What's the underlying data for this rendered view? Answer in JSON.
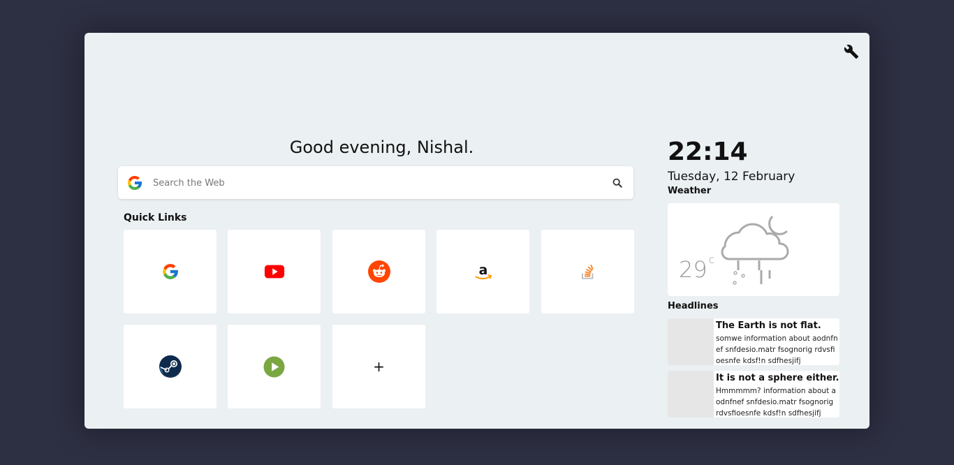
{
  "greeting": "Good evening, Nishal.",
  "search": {
    "placeholder": "Search the Web"
  },
  "quick_links": {
    "title": "Quick Links",
    "items": [
      {
        "icon": "google-icon"
      },
      {
        "icon": "youtube-icon"
      },
      {
        "icon": "reddit-icon"
      },
      {
        "icon": "amazon-icon"
      },
      {
        "icon": "stackoverflow-icon"
      },
      {
        "icon": "steam-icon"
      },
      {
        "icon": "play-icon"
      },
      {
        "icon": "plus-icon",
        "label": "+"
      }
    ]
  },
  "clock": {
    "time": "22:14",
    "date": "Tuesday, 12 February"
  },
  "weather": {
    "title": "Weather",
    "temp": "29",
    "unit": "c",
    "icon": "cloud-moon-rain-snow-icon"
  },
  "headlines": {
    "title": "Headlines",
    "items": [
      {
        "title": "The Earth is not flat.",
        "desc": "somwe information about aodnfnef snfdesio.matr fsognorig rdvsfioesnfe kdsf!n sdfhesjifj"
      },
      {
        "title": "It is not a sphere either.",
        "desc": "Hmmmmm? information about aodnfnef snfdesio.matr fsognorig rdvsfioesnfe kdsf!n sdfhesjifj"
      }
    ]
  },
  "colors": {
    "background": "#2d2f42",
    "panel": "#ebf0f2"
  }
}
